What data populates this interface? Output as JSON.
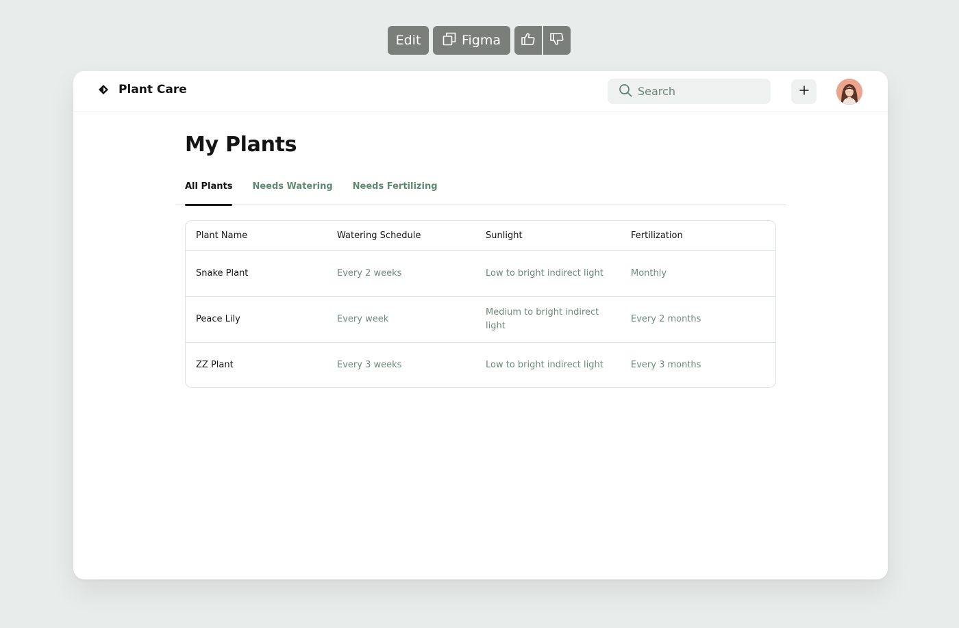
{
  "toolbar": {
    "edit_label": "Edit",
    "figma_label": "Figma",
    "icons": [
      "copy-icon",
      "thumbs-up-icon",
      "thumbs-down-icon"
    ]
  },
  "header": {
    "brand": "Plant Care",
    "search_placeholder": "Search",
    "icons": [
      "brand-logo-icon",
      "search-icon",
      "plus-icon"
    ]
  },
  "page": {
    "title": "My Plants"
  },
  "tabs": [
    {
      "label": "All Plants",
      "active": true
    },
    {
      "label": "Needs Watering",
      "active": false
    },
    {
      "label": "Needs Fertilizing",
      "active": false
    }
  ],
  "table": {
    "columns": [
      "Plant Name",
      "Watering Schedule",
      "Sunlight",
      "Fertilization"
    ],
    "rows": [
      [
        "Snake Plant",
        "Every 2 weeks",
        "Low to bright indirect light",
        "Monthly"
      ],
      [
        "Peace Lily",
        "Every week",
        "Medium to bright indirect light",
        "Every 2 months"
      ],
      [
        "ZZ Plant",
        "Every 3 weeks",
        "Low to bright indirect light",
        "Every 3 months"
      ]
    ]
  },
  "colors": {
    "background": "#e8ecea",
    "accent_green": "#5f8a72",
    "muted_text": "#6a8a7a",
    "toolbar_gray": "#7a7f7c"
  }
}
